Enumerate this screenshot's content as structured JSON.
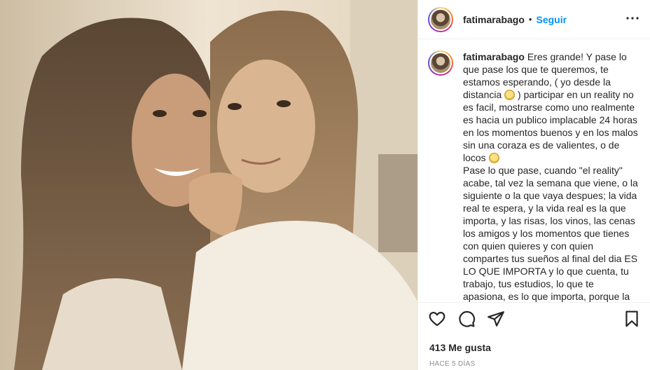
{
  "photo": {
    "alt": ""
  },
  "header": {
    "username": "fatimarabago",
    "separator": "•",
    "follow_label": "Seguir",
    "more_label": "•••"
  },
  "comment": {
    "username": "fatimarabago",
    "text_lines": [
      "Eres grande! Y pase lo que",
      "pase los que te queremos, te estamos",
      "esperando, ( yo desde la distancia",
      ") participar en un reality no es facil,",
      "mostrarse como uno realmente es hacia",
      "un publico implacable  24 horas en los",
      "momentos buenos y en los malos sin una",
      "coraza es de valientes, o de locos",
      "Pase lo que pase, cuando \"el reality\"",
      "acabe, tal vez la semana que viene, o la",
      "siguiente o la que vaya despues; la vida",
      "real te espera, y la vida real es la que",
      "importa, y las risas, los vinos, las cenas",
      "los amigos y los momentos que tienes",
      "con quien quieres y con quien compartes",
      "tus sueños al final del dia ES LO QUE",
      "IMPORTA y lo que cuenta, tu trabajo, tus",
      "estudios, lo que te apasiona, es lo que",
      "importa, porque la vida es eso,"
    ]
  },
  "actions": {
    "like_icon": "heart-icon",
    "comment_icon": "comment-icon",
    "share_icon": "paper-plane-icon",
    "save_icon": "bookmark-icon"
  },
  "likes_text": "413 Me gusta",
  "timestamp": "HACE 5 DÍAS",
  "colors": {
    "link_blue": "#0095f6",
    "text": "#262626",
    "muted": "#8e8e8e"
  }
}
